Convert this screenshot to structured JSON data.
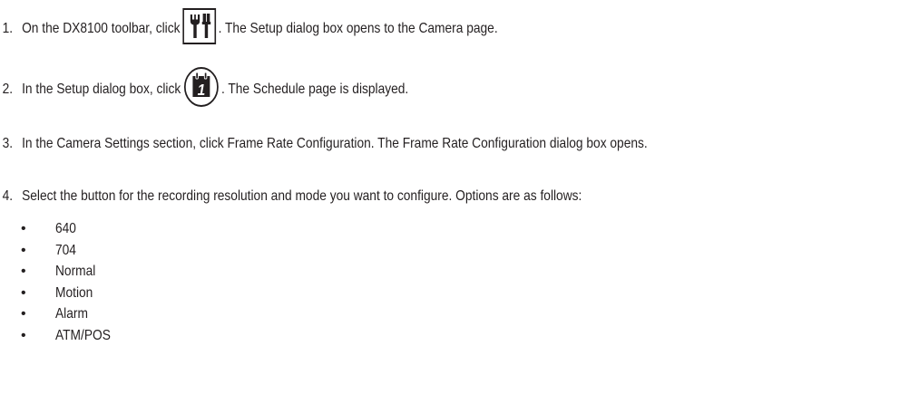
{
  "steps": [
    {
      "number": "1.",
      "before": "On the DX8100 toolbar, click",
      "icon": "setup-tools-icon",
      "after": ". The Setup dialog box opens to the Camera page."
    },
    {
      "number": "2.",
      "before": "In the Setup dialog box, click",
      "icon": "schedule-calendar-icon",
      "after": ". The Schedule page is displayed."
    },
    {
      "number": "3.",
      "text": "In the Camera Settings section, click Frame Rate Configuration. The Frame Rate Configuration dialog box opens."
    },
    {
      "number": "4.",
      "text": "Select the button for the recording resolution and mode you want to configure. Options are as follows:"
    }
  ],
  "options": [
    {
      "bullet": "•",
      "label": "640"
    },
    {
      "bullet": "•",
      "label": "704"
    },
    {
      "bullet": "•",
      "label": "Normal"
    },
    {
      "bullet": "•",
      "label": "Motion"
    },
    {
      "bullet": "•",
      "label": "Alarm"
    },
    {
      "bullet": "•",
      "label": "ATM/POS"
    }
  ],
  "icons": {
    "schedule_day": "1"
  },
  "colors": {
    "text": "#231f20",
    "icon": "#231f20"
  }
}
